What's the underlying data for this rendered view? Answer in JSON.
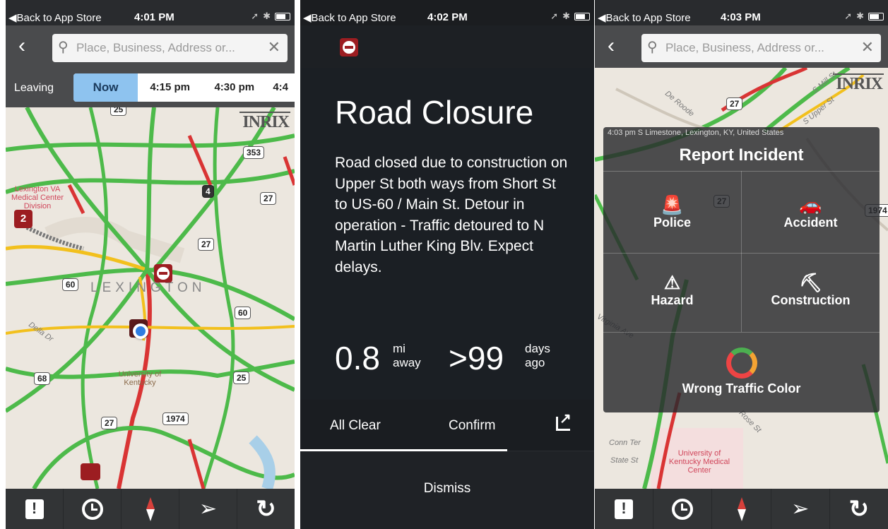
{
  "colors": {
    "traffic_green": "#4dba4a",
    "traffic_yellow": "#f2c01d",
    "traffic_red": "#d93434",
    "selected_time": "#8ec3ef",
    "marker_red": "#9c1d21"
  },
  "panel1": {
    "status": {
      "back": "◀Back to App Store",
      "time": "4:01 PM"
    },
    "search": {
      "back_icon": "chevron-left-icon",
      "placeholder": "Place, Business, Address or..."
    },
    "leaving": {
      "label": "Leaving",
      "options": [
        "Now",
        "4:15 pm",
        "4:30 pm",
        "4:4"
      ],
      "selected": "Now"
    },
    "map": {
      "brand": "INRIX",
      "city": "LEXINGTON",
      "streets": [
        "Della Dr"
      ],
      "pois": [
        "Lexington VA Medical Center Division",
        "University of Kentucky"
      ],
      "shields": [
        "25",
        "353",
        "4",
        "27",
        "27",
        "60",
        "60",
        "68",
        "25",
        "27",
        "1974"
      ],
      "cluster_count": "2"
    },
    "tabs": [
      "report-icon",
      "clock-icon",
      "compass-icon",
      "location-arrow-icon",
      "refresh-icon"
    ]
  },
  "panel2": {
    "status": {
      "back": "◀Back to App Store",
      "time": "4:02 PM"
    },
    "incident": {
      "title": "Road Closure",
      "description": "Road closed due to construction on Upper St both ways from Short St to US-60 / Main St. Detour in operation -  Traffic detoured to N Martin Luther King Blv. Expect delays.",
      "distance_value": "0.8",
      "distance_unit_top": "mi",
      "distance_unit_bottom": "away",
      "age_value": ">99",
      "age_unit_top": "days",
      "age_unit_bottom": "ago"
    },
    "actions": {
      "all_clear": "All Clear",
      "confirm": "Confirm",
      "dismiss": "Dismiss"
    }
  },
  "panel3": {
    "status": {
      "back": "◀Back to App Store",
      "time": "4:03 PM"
    },
    "search": {
      "placeholder": "Place, Business, Address or..."
    },
    "map": {
      "brand": "INRIX",
      "streets": [
        "De Roode",
        "S Mill St",
        "S Upper St",
        "Virginia Ave",
        "Conn Ter",
        "State St",
        "Rose St"
      ],
      "poi": "University of Kentucky Medical Center",
      "shields": [
        "27",
        "27",
        "1974"
      ]
    },
    "popup": {
      "location": "4:03 pm  S Limestone, Lexington, KY, United States",
      "title": "Report Incident",
      "options": [
        "Police",
        "Accident",
        "Hazard",
        "Construction",
        "Wrong Traffic Color"
      ]
    }
  }
}
